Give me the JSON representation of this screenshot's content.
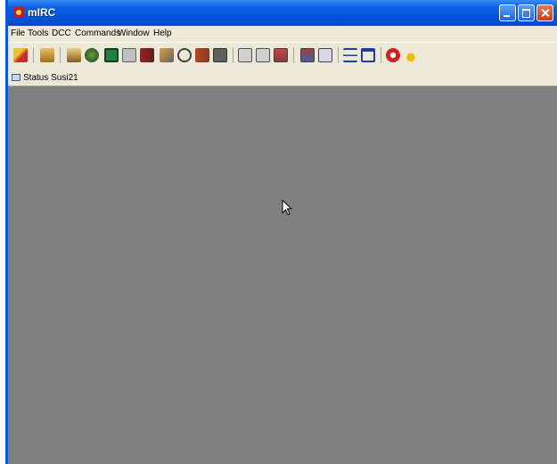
{
  "window": {
    "title": "mIRC"
  },
  "menu": [
    "File",
    "Tools",
    "DCC",
    "Commands",
    "Window",
    "Help"
  ],
  "toolbar": {
    "icons": [
      "connect-icon",
      "options-icon",
      "channels-icon",
      "favorites-icon",
      "address-book-icon",
      "notify-icon",
      "dcc-send-icon",
      "dcc-chat-icon",
      "dcc-options-icon",
      "timer-icon",
      "colors-icon",
      "online-icon",
      "log-icon",
      "script-icon",
      "alias-icon",
      "popups-icon",
      "remote-icon",
      "users-icon",
      "tile-icon",
      "cascade-icon",
      "help-icon",
      "about-icon"
    ]
  },
  "switchbar": {
    "status_label": "Status Susi21"
  },
  "colors": {
    "titlebar": "#0553d8",
    "mdi_background": "#808080",
    "chrome": "#ece9d8"
  }
}
